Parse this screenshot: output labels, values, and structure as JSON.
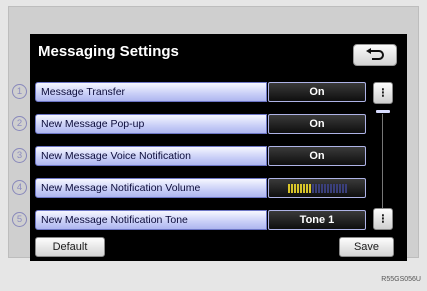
{
  "title": "Messaging Settings",
  "back_icon": "return-arrow-icon",
  "rows": [
    {
      "number": "1",
      "label": "Message Transfer",
      "value": "On"
    },
    {
      "number": "2",
      "label": "New Message Pop-up",
      "value": "On"
    },
    {
      "number": "3",
      "label": "New Message Voice Notification",
      "value": "On"
    },
    {
      "number": "4",
      "label": "New Message Notification Volume",
      "volume_level": 0.4
    },
    {
      "number": "5",
      "label": "New Message Notification Tone",
      "value": "Tone 1"
    }
  ],
  "scroll": {
    "up_icon": "scroll-up-icon",
    "down_icon": "scroll-down-icon"
  },
  "buttons": {
    "default_label": "Default",
    "save_label": "Save"
  },
  "image_caption": "R55GS056U",
  "colors": {
    "screen_bg": "#000000",
    "label_blue": "#c8cef7",
    "volume_active": "#d8c42a",
    "volume_inactive": "#3a3f7a"
  }
}
